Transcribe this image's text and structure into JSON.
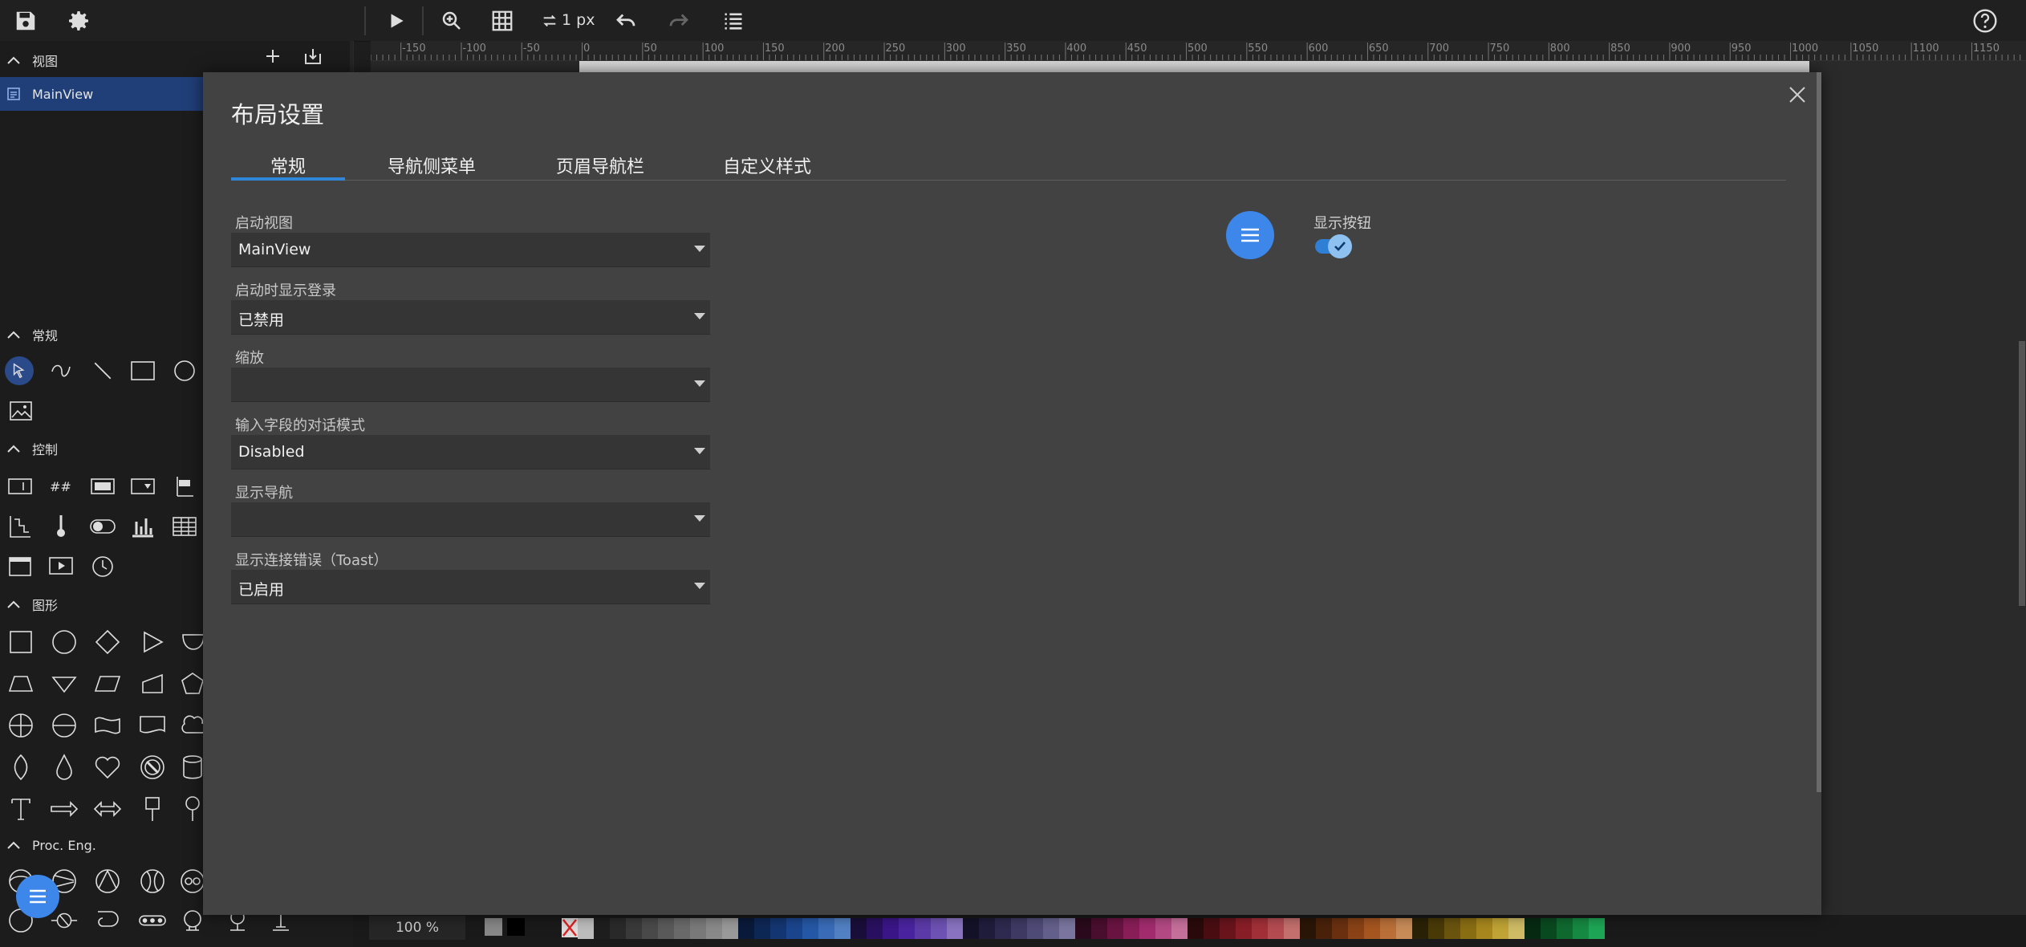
{
  "toolbar": {
    "stroke_width": "1 px",
    "icons": [
      "save-icon",
      "gear-icon",
      "play-icon",
      "zoom-icon",
      "grid-icon",
      "stroke-width-icon",
      "undo-icon",
      "redo-icon",
      "list-icon",
      "help-icon"
    ]
  },
  "sidebar": {
    "views_section": "视图",
    "view_item": "MainView",
    "general_section": "常规",
    "controls_section": "控制",
    "shapes_section": "图形",
    "proc_section": "Proc. Eng."
  },
  "ruler": {
    "ticks": [
      "-150",
      "-100",
      "-50",
      "0",
      "50",
      "100",
      "150",
      "200",
      "250",
      "300",
      "350",
      "400",
      "450",
      "500",
      "550",
      "600",
      "650",
      "700",
      "750",
      "800",
      "850",
      "900",
      "950",
      "1000",
      "1050",
      "1100",
      "1150"
    ]
  },
  "bottombar": {
    "zoom": "100 %"
  },
  "modal": {
    "title": "布局设置",
    "tabs": [
      {
        "label": "常规"
      },
      {
        "label": "导航侧菜单"
      },
      {
        "label": "页眉导航栏"
      },
      {
        "label": "自定义样式"
      }
    ],
    "fields": [
      {
        "label": "启动视图",
        "value": "MainView"
      },
      {
        "label": "启动时显示登录",
        "value": "已禁用"
      },
      {
        "label": "缩放",
        "value": ""
      },
      {
        "label": "输入字段的对话模式",
        "value": "Disabled"
      },
      {
        "label": "显示导航",
        "value": ""
      },
      {
        "label": "显示连接错误（Toast）",
        "value": "已启用"
      }
    ],
    "show_button_label": "显示按钮",
    "show_button_on": true
  },
  "colors": {
    "accent": "#2f86d8",
    "fab": "#3d87eb",
    "modal_bg": "#424242",
    "selected_view": "#203e77"
  }
}
